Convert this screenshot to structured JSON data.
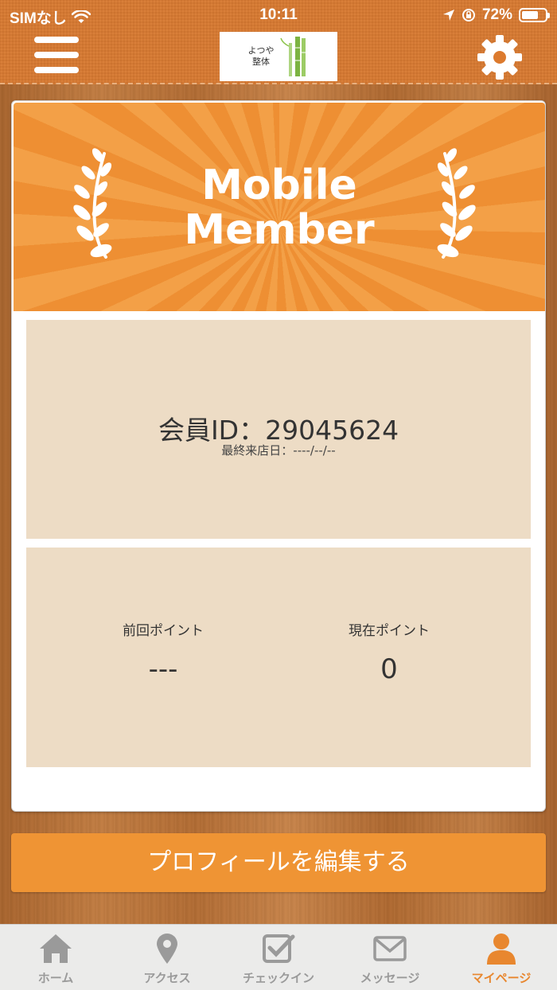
{
  "status_bar": {
    "carrier": "SIMなし",
    "time": "10:11",
    "battery": "72%",
    "battery_level": 0.72
  },
  "header": {
    "logo_text": "よつや 整体"
  },
  "banner": {
    "title_line1": "Mobile",
    "title_line2": "Member"
  },
  "member": {
    "id_label": "会員ID：",
    "id_value": "29045624",
    "last_visit": "最終来店日：----/--/--"
  },
  "points": {
    "previous_label": "前回ポイント",
    "previous_value": "---",
    "current_label": "現在ポイント",
    "current_value": "0"
  },
  "actions": {
    "edit_profile": "プロフィールを編集する"
  },
  "tabs": [
    {
      "label": "ホーム",
      "icon": "home-icon",
      "active": false
    },
    {
      "label": "アクセス",
      "icon": "map-pin-icon",
      "active": false
    },
    {
      "label": "チェックイン",
      "icon": "checkbox-icon",
      "active": false
    },
    {
      "label": "メッセージ",
      "icon": "envelope-icon",
      "active": false
    },
    {
      "label": "マイページ",
      "icon": "user-icon",
      "active": true
    }
  ],
  "colors": {
    "accent": "#ef9434",
    "header": "#dc7a2e",
    "panel": "#eddcc5",
    "tab_active": "#e8872f",
    "tab_inactive": "#9a9a9a"
  }
}
